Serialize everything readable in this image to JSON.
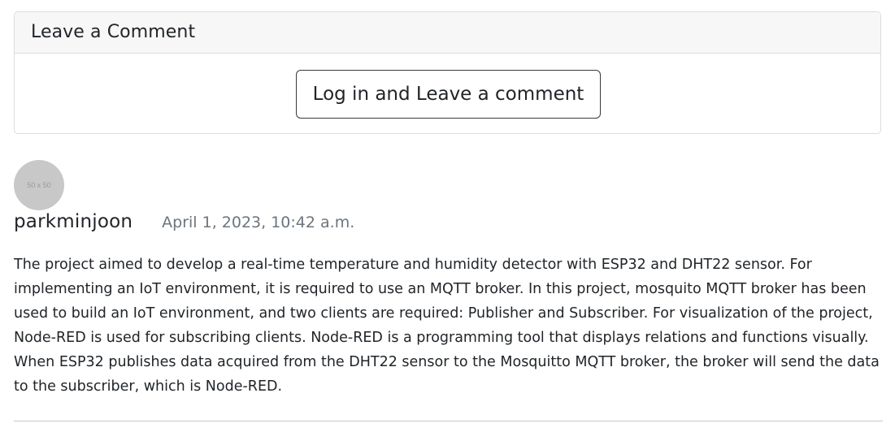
{
  "comment_section": {
    "title": "Leave a Comment",
    "login_button_label": "Log in and Leave a comment"
  },
  "comment": {
    "avatar_label": "50 x 50",
    "author": "parkminjoon",
    "date": "April 1, 2023, 10:42 a.m.",
    "text": "The project aimed to develop a real-time temperature and humidity detector with ESP32 and DHT22 sensor. For implementing an IoT environment, it is required to use an MQTT broker. In this project, mosquito MQTT broker has been used to build an IoT environment, and two clients are required: Publisher and Subscriber. For visualization of the project, Node-RED is used for subscribing clients. Node-RED is a programming tool that displays relations and functions visually. When ESP32 publishes data acquired from the DHT22 sensor to the Mosquitto MQTT broker, the broker will send the data to the subscriber, which is Node-RED."
  },
  "colors": {
    "header_background": "#f7f7f7",
    "border": "#dcdcdc",
    "button_border": "#343a40",
    "avatar_background": "#c8c8c8",
    "muted_text": "#6c757d"
  }
}
